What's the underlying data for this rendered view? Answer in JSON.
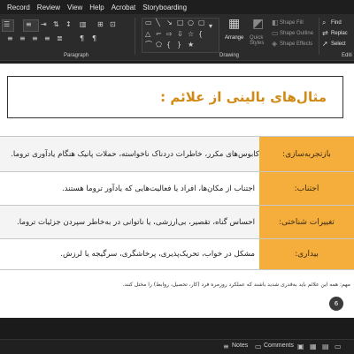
{
  "menubar": [
    "Record",
    "Review",
    "View",
    "Help",
    "Acrobat",
    "Storyboarding"
  ],
  "ribbon": {
    "paragraph_label": "Paragraph",
    "drawing_label": "Drawing",
    "editing_label": "Editi",
    "arrange_label": "Arrange",
    "quick_styles_label": "Quick\nStyles",
    "shape_fill_label": "Shape Fill",
    "shape_outline_label": "Shape Outline",
    "shape_effects_label": "Shape Effects",
    "find_label": "Find",
    "replace_label": "Replac",
    "select_label": "Select"
  },
  "slide": {
    "title": "مثال‌های بالینی از علائم :",
    "rows": [
      {
        "category": "بازتجربه‌سازی:",
        "description": "کابوس‌های مکرر، خاطرات دردناک ناخواسته، حملات پانیک هنگام یادآوری تروما."
      },
      {
        "category": "اجتناب:",
        "description": "اجتناب از مکان‌ها، افراد یا فعالیت‌هایی که یادآور تروما هستند."
      },
      {
        "category": "تغییرات شناختی:",
        "description": "احساس گناه، تقصیر، بی‌ارزشی، یا ناتوانی در به‌خاطر سپردن جزئیات تروما."
      },
      {
        "category": "بیداری:",
        "description": "مشکل در خواب، تحریک‌پذیری، پرخاشگری، سرگیجه یا لرزش."
      }
    ],
    "footnote": "مهم: همه این علائم باید به‌قدری شدید باشند که عملکرد روزمره فرد (کار، تحصیل، روابط) را مختل کنند.",
    "page_number": "6"
  },
  "statusbar": {
    "notes_label": "Notes",
    "comments_label": "Comments"
  },
  "colors": {
    "title": "#d18a16",
    "category_fill": "#f5ad3c",
    "ribbon_bg": "#2b2b2b"
  }
}
